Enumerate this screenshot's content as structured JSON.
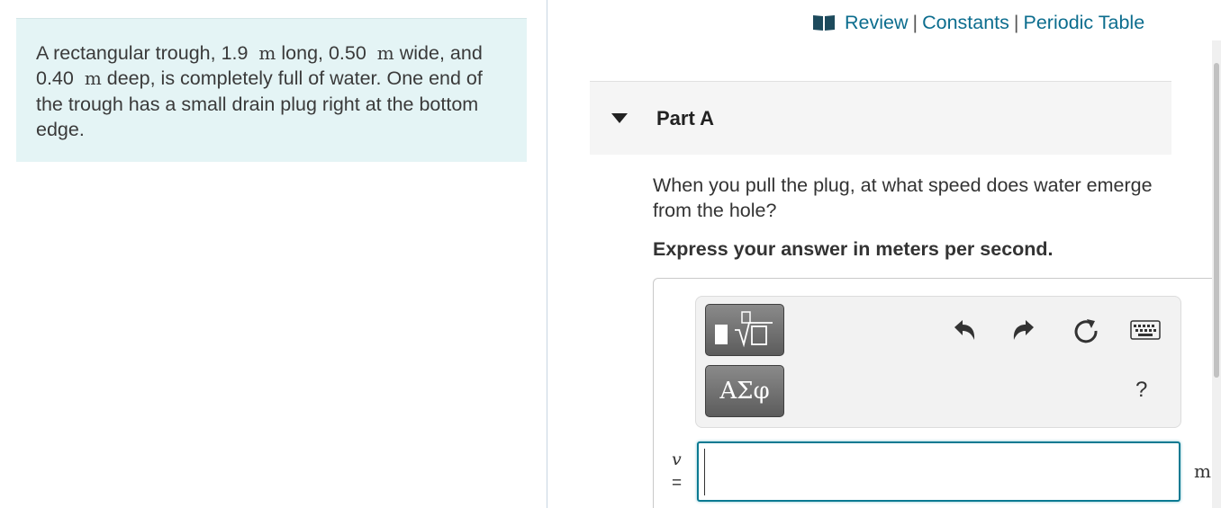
{
  "problem": {
    "t1": "A rectangular trough, 1.9",
    "u1": "m",
    "t2": "long, 0.50",
    "u2": "m",
    "t3": "wide, and 0.40",
    "u3": "m",
    "t4": "deep, is completely full of water. One end of the trough has a small drain plug right at the bottom edge."
  },
  "toplinks": {
    "review": "Review",
    "constants": "Constants",
    "periodic_table": "Periodic Table",
    "separator": "|"
  },
  "part": {
    "title": "Part A"
  },
  "question": "When you pull the plug, at what speed does water emerge from the hole?",
  "instruction": "Express your answer in meters per second.",
  "toolbar": {
    "greek_label": "ΑΣφ",
    "help_label": "?",
    "icons": [
      "templates-icon",
      "undo-icon",
      "redo-icon",
      "reset-icon",
      "keyboard-icon"
    ]
  },
  "answer": {
    "variable": "v",
    "equals": "=",
    "value": "",
    "unit": "m"
  },
  "colors": {
    "link": "#0c6d8e",
    "problem_bg": "#e4f4f5",
    "input_border": "#0b7a92"
  }
}
